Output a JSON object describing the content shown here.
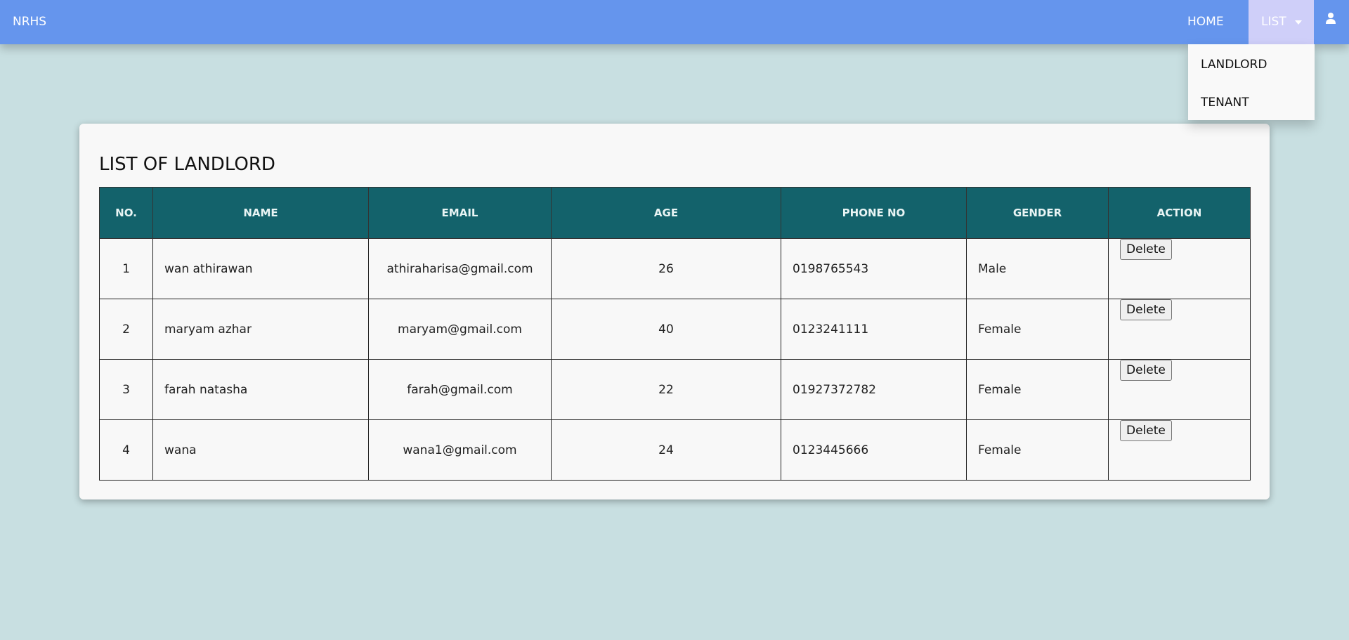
{
  "navbar": {
    "brand": "NRHS",
    "home": "HOME",
    "list": "LIST",
    "dropdown": [
      "LANDLORD",
      "TENANT"
    ]
  },
  "page": {
    "title": "LIST OF LANDLORD"
  },
  "table": {
    "headers": [
      "NO.",
      "NAME",
      "EMAIL",
      "AGE",
      "PHONE NO",
      "GENDER",
      "ACTION"
    ],
    "rows": [
      {
        "no": "1",
        "name": "wan athirawan",
        "email": "athiraharisa@gmail.com",
        "age": "26",
        "phone": "0198765543",
        "gender": "Male",
        "action": "Delete"
      },
      {
        "no": "2",
        "name": "maryam azhar",
        "email": "maryam@gmail.com",
        "age": "40",
        "phone": "0123241111",
        "gender": "Female",
        "action": "Delete"
      },
      {
        "no": "3",
        "name": "farah natasha",
        "email": "farah@gmail.com",
        "age": "22",
        "phone": "01927372782",
        "gender": "Female",
        "action": "Delete"
      },
      {
        "no": "4",
        "name": "wana",
        "email": "wana1@gmail.com",
        "age": "24",
        "phone": "0123445666",
        "gender": "Female",
        "action": "Delete"
      }
    ]
  },
  "icons": {
    "user": "user-icon",
    "caret": "caret-down-icon"
  },
  "colors": {
    "navbar": "#6595ed",
    "active_nav": "#cfcff9",
    "page_bg": "#c8dfe1",
    "card_bg": "#f8f8f8",
    "table_header": "#13626b"
  }
}
